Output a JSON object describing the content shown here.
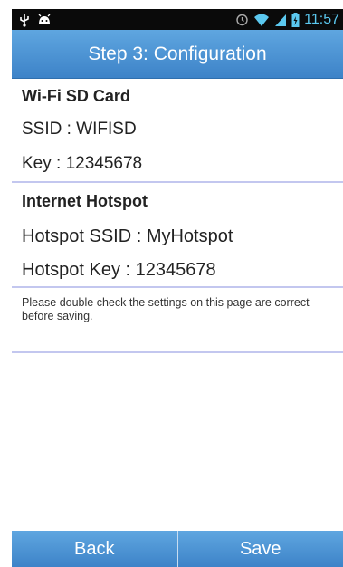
{
  "statusbar": {
    "time": "11:57",
    "icons": [
      "usb-icon",
      "android-debug-icon",
      "alarm-icon",
      "wifi-icon",
      "signal-icon",
      "battery-icon"
    ]
  },
  "header": {
    "title": "Step 3: Configuration"
  },
  "wifi_sd": {
    "title": "Wi-Fi SD Card",
    "ssid": "SSID : WIFISD",
    "key": "Key : 12345678"
  },
  "hotspot": {
    "title": "Internet Hotspot",
    "ssid": "Hotspot SSID : MyHotspot",
    "key": "Hotspot Key : 12345678"
  },
  "note": "Please double check the settings on this page are correct before saving.",
  "buttons": {
    "back": "Back",
    "save": "Save"
  },
  "colors": {
    "accent": "#4a90d4",
    "divider": "#c3c7ef",
    "status_time": "#5bc8ef"
  }
}
